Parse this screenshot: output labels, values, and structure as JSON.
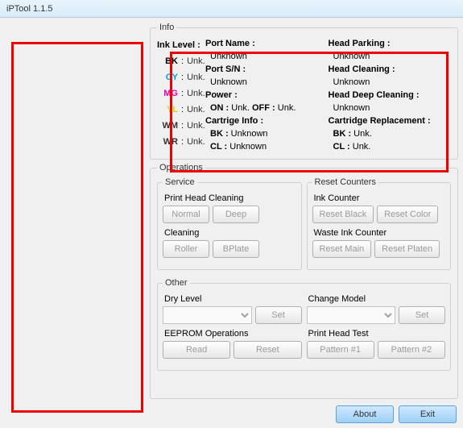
{
  "title": "iPTool 1.1.5",
  "info": {
    "legend": "Info",
    "inks": [
      {
        "name": "BK",
        "color": "#000",
        "value": "Unk."
      },
      {
        "name": "CY",
        "color": "#00a0e0",
        "value": "Unk."
      },
      {
        "name": "MG",
        "color": "#e000b0",
        "value": "Unk."
      },
      {
        "name": "YL",
        "color": "#e0d000",
        "value": "Unk."
      },
      {
        "name": "WM",
        "color": "#333",
        "value": "Unk."
      },
      {
        "name": "WR",
        "color": "#333",
        "value": "Unk."
      }
    ],
    "ink_level_header": "Ink Level :",
    "col2": {
      "port_name": "Port Name :",
      "port_name_v": "Unknown",
      "port_sn": "Port S/N :",
      "port_sn_v": "Unknown",
      "power": "Power :",
      "power_on": "ON :",
      "power_on_v": "Unk.",
      "power_off": "OFF :",
      "power_off_v": "Unk.",
      "cart": "Cartrige Info :",
      "cart_bk": "BK :",
      "cart_bk_v": "Unknown",
      "cart_cl": "CL :",
      "cart_cl_v": "Unknown"
    },
    "col3": {
      "parking": "Head Parking :",
      "parking_v": "Unknown",
      "cleaning": "Head Cleaning :",
      "cleaning_v": "Unknown",
      "deep": "Head Deep Cleaning :",
      "deep_v": "Unknown",
      "repl": "Cartridge Replacement :",
      "repl_bk": "BK :",
      "repl_bk_v": "Unk.",
      "repl_cl": "CL :",
      "repl_cl_v": "Unk."
    }
  },
  "ops": {
    "legend": "Operations",
    "service": {
      "legend": "Service",
      "phc": "Print Head Cleaning",
      "phc_normal": "Normal",
      "phc_deep": "Deep",
      "clean": "Cleaning",
      "roller": "Roller",
      "bplate": "BPlate"
    },
    "reset": {
      "legend": "Reset Counters",
      "ink": "Ink Counter",
      "rblack": "Reset Black",
      "rcolor": "Reset Color",
      "waste": "Waste Ink Counter",
      "rmain": "Reset Main",
      "rplaten": "Reset Platen"
    },
    "other": {
      "legend": "Other",
      "dry": "Dry Level",
      "set1": "Set",
      "eeprom": "EEPROM Operations",
      "read": "Read",
      "reset_e": "Reset",
      "model": "Change Model",
      "set2": "Set",
      "pht": "Print Head Test",
      "p1": "Pattern #1",
      "p2": "Pattern #2"
    }
  },
  "bottom": {
    "about": "About",
    "exit": "Exit"
  }
}
